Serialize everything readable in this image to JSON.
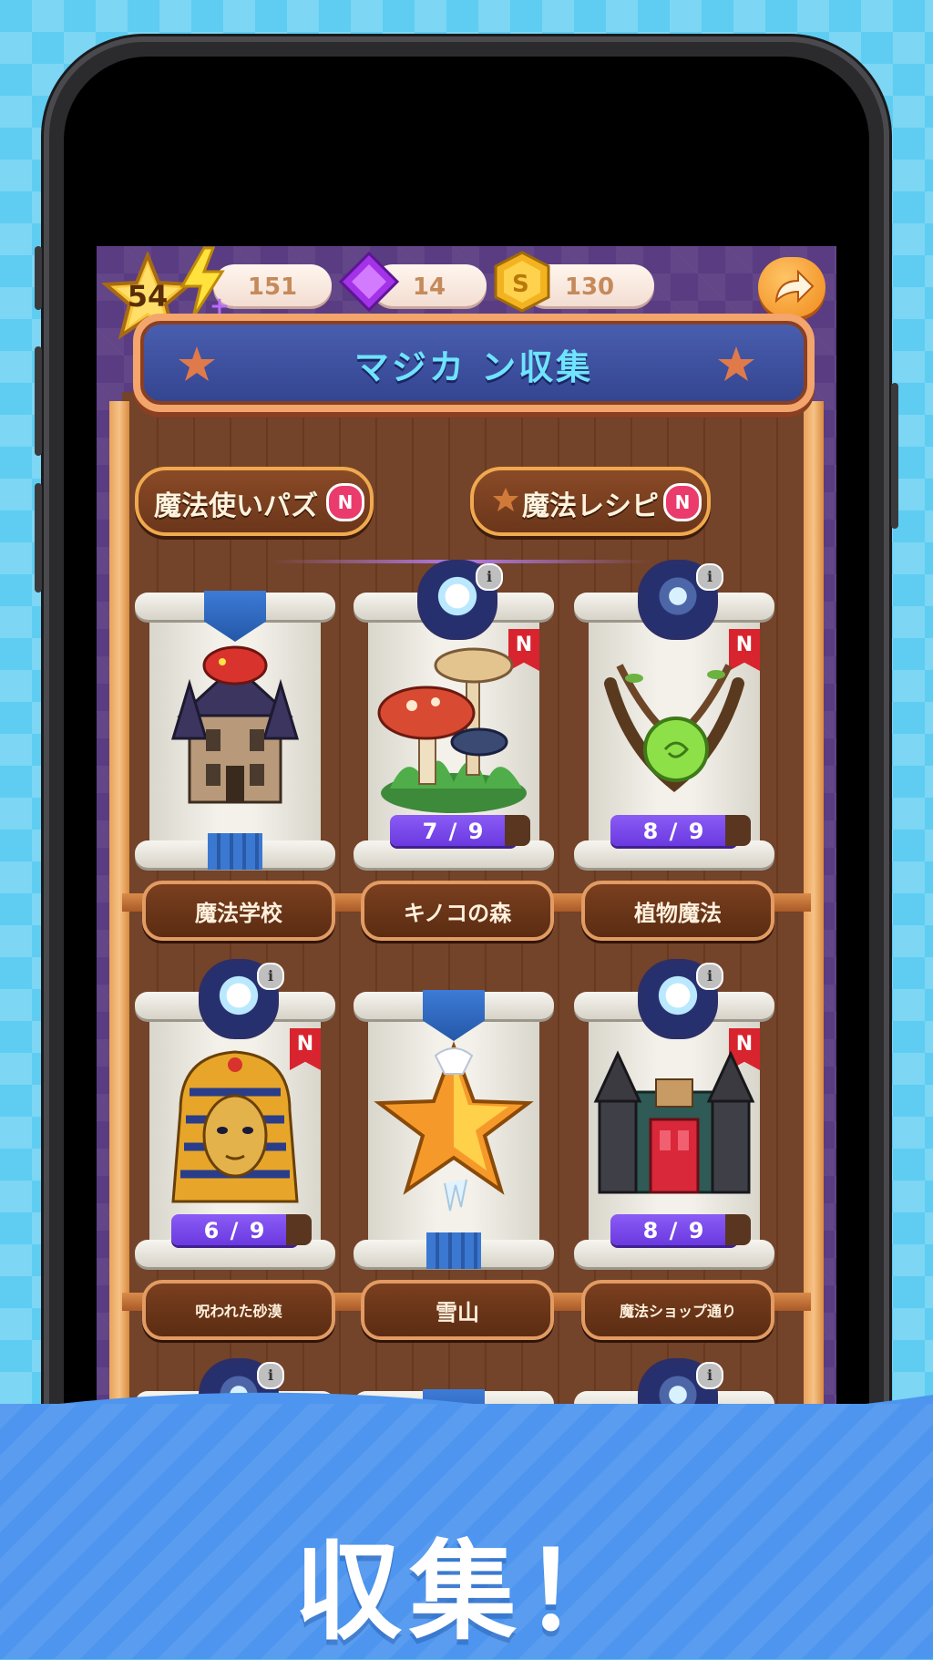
{
  "hud": {
    "level": "54",
    "energy": "151",
    "gems": "14",
    "coins": "130"
  },
  "header": {
    "title": "マジカ ン収集"
  },
  "tabs": [
    {
      "label": "魔法使いパズ",
      "badge": "N"
    },
    {
      "label": "魔法レシピ",
      "badge": "N"
    }
  ],
  "cards": [
    {
      "name": "魔法学校",
      "progress": "",
      "new": false,
      "top": "ribbon"
    },
    {
      "name": "キノコの森",
      "progress": "7/9",
      "new": true,
      "new_label": "N",
      "top": "orb"
    },
    {
      "name": "植物魔法",
      "progress": "8/9",
      "new": true,
      "new_label": "N",
      "top": "star-orb"
    },
    {
      "name": "呪われた砂漠",
      "progress": "6/9",
      "new": true,
      "new_label": "N",
      "top": "orb"
    },
    {
      "name": "雪山",
      "progress": "",
      "new": false,
      "top": "ribbon"
    },
    {
      "name": "魔法ショップ通り",
      "progress": "8/9",
      "new": true,
      "new_label": "N",
      "top": "orb"
    }
  ],
  "info_label": "i",
  "promo_text": "収集！",
  "colors": {
    "background": "#5fcdf2",
    "screen": "#5a3c82",
    "banner": "#33448f",
    "progress": "#6a3ae0",
    "wave": "#4d95ee"
  }
}
